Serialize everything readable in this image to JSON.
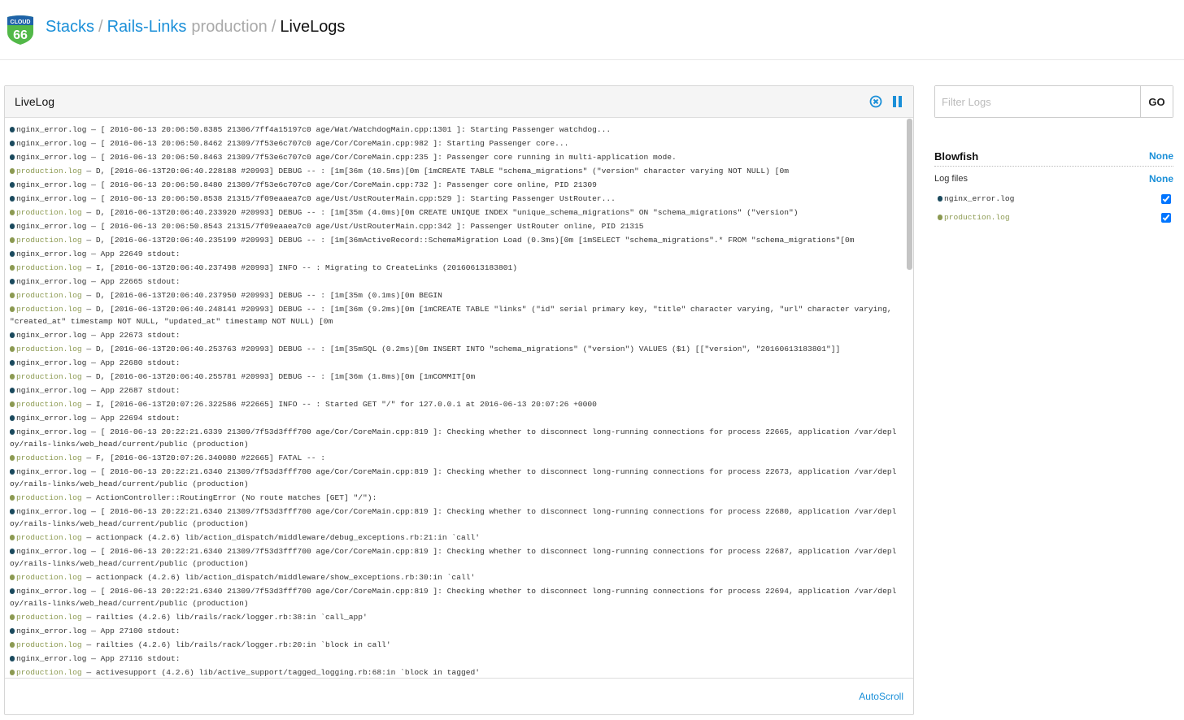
{
  "header": {
    "logo_text": [
      "CLOUD",
      "66"
    ],
    "breadcrumb": {
      "stacks": "Stacks",
      "separator": "/",
      "stack": "Rails-Links",
      "environment": "production",
      "current": "LiveLogs"
    }
  },
  "colors": {
    "accent": "#1a8fd8",
    "nginx": "#1b4a5e",
    "production": "#8c9a52"
  },
  "livelog": {
    "title": "LiveLog",
    "clear_icon": "close-circle-icon",
    "pause_icon": "pause-icon",
    "autoscroll": "AutoScroll",
    "separator": " — ",
    "entries": [
      {
        "src": "nginx_error.log",
        "text": "[ 2016-06-13 20:06:50.8385 21306/7ff4a15197c0 age/Wat/WatchdogMain.cpp:1301 ]: Starting Passenger watchdog..."
      },
      {
        "src": "nginx_error.log",
        "text": "[ 2016-06-13 20:06:50.8462 21309/7f53e6c707c0 age/Cor/CoreMain.cpp:982 ]: Starting Passenger core..."
      },
      {
        "src": "nginx_error.log",
        "text": "[ 2016-06-13 20:06:50.8463 21309/7f53e6c707c0 age/Cor/CoreMain.cpp:235 ]: Passenger core running in multi-application mode."
      },
      {
        "src": "production.log",
        "text": "D, [2016-06-13T20:06:40.228188 #20993] DEBUG -- : [1m[36m (10.5ms)[0m [1mCREATE TABLE \"schema_migrations\" (\"version\" character varying NOT NULL) [0m"
      },
      {
        "src": "nginx_error.log",
        "text": "[ 2016-06-13 20:06:50.8480 21309/7f53e6c707c0 age/Cor/CoreMain.cpp:732 ]: Passenger core online, PID 21309"
      },
      {
        "src": "nginx_error.log",
        "text": "[ 2016-06-13 20:06:50.8538 21315/7f09eaaea7c0 age/Ust/UstRouterMain.cpp:529 ]: Starting Passenger UstRouter..."
      },
      {
        "src": "production.log",
        "text": "D, [2016-06-13T20:06:40.233920 #20993] DEBUG -- : [1m[35m (4.0ms)[0m CREATE UNIQUE INDEX \"unique_schema_migrations\" ON \"schema_migrations\" (\"version\")"
      },
      {
        "src": "nginx_error.log",
        "text": "[ 2016-06-13 20:06:50.8543 21315/7f09eaaea7c0 age/Ust/UstRouterMain.cpp:342 ]: Passenger UstRouter online, PID 21315"
      },
      {
        "src": "production.log",
        "text": "D, [2016-06-13T20:06:40.235199 #20993] DEBUG -- : [1m[36mActiveRecord::SchemaMigration Load (0.3ms)[0m [1mSELECT \"schema_migrations\".* FROM \"schema_migrations\"[0m"
      },
      {
        "src": "nginx_error.log",
        "text": "App 22649 stdout:"
      },
      {
        "src": "production.log",
        "text": "I, [2016-06-13T20:06:40.237498 #20993] INFO -- : Migrating to CreateLinks (20160613183801)"
      },
      {
        "src": "nginx_error.log",
        "text": "App 22665 stdout:"
      },
      {
        "src": "production.log",
        "text": "D, [2016-06-13T20:06:40.237950 #20993] DEBUG -- : [1m[35m (0.1ms)[0m BEGIN"
      },
      {
        "src": "production.log",
        "text": "D, [2016-06-13T20:06:40.248141 #20993] DEBUG -- : [1m[36m (9.2ms)[0m [1mCREATE TABLE \"links\" (\"id\" serial primary key, \"title\" character varying, \"url\" character varying, \"created_at\" timestamp NOT NULL, \"updated_at\" timestamp NOT NULL) [0m"
      },
      {
        "src": "nginx_error.log",
        "text": "App 22673 stdout:"
      },
      {
        "src": "production.log",
        "text": "D, [2016-06-13T20:06:40.253763 #20993] DEBUG -- : [1m[35mSQL (0.2ms)[0m INSERT INTO \"schema_migrations\" (\"version\") VALUES ($1) [[\"version\", \"20160613183801\"]]"
      },
      {
        "src": "nginx_error.log",
        "text": "App 22680 stdout:"
      },
      {
        "src": "production.log",
        "text": "D, [2016-06-13T20:06:40.255781 #20993] DEBUG -- : [1m[36m (1.8ms)[0m [1mCOMMIT[0m"
      },
      {
        "src": "nginx_error.log",
        "text": "App 22687 stdout:"
      },
      {
        "src": "production.log",
        "text": "I, [2016-06-13T20:07:26.322586 #22665] INFO -- : Started GET \"/\" for 127.0.0.1 at 2016-06-13 20:07:26 +0000"
      },
      {
        "src": "nginx_error.log",
        "text": "App 22694 stdout:"
      },
      {
        "src": "nginx_error.log",
        "text": "[ 2016-06-13 20:22:21.6339 21309/7f53d3fff700 age/Cor/CoreMain.cpp:819 ]: Checking whether to disconnect long-running connections for process 22665, application /var/deploy/rails-links/web_head/current/public (production)"
      },
      {
        "src": "production.log",
        "text": "F, [2016-06-13T20:07:26.340080 #22665] FATAL -- :"
      },
      {
        "src": "nginx_error.log",
        "text": "[ 2016-06-13 20:22:21.6340 21309/7f53d3fff700 age/Cor/CoreMain.cpp:819 ]: Checking whether to disconnect long-running connections for process 22673, application /var/deploy/rails-links/web_head/current/public (production)"
      },
      {
        "src": "production.log",
        "text": "ActionController::RoutingError (No route matches [GET] \"/\"):"
      },
      {
        "src": "nginx_error.log",
        "text": "[ 2016-06-13 20:22:21.6340 21309/7f53d3fff700 age/Cor/CoreMain.cpp:819 ]: Checking whether to disconnect long-running connections for process 22680, application /var/deploy/rails-links/web_head/current/public (production)"
      },
      {
        "src": "production.log",
        "text": "actionpack (4.2.6) lib/action_dispatch/middleware/debug_exceptions.rb:21:in `call'"
      },
      {
        "src": "nginx_error.log",
        "text": "[ 2016-06-13 20:22:21.6340 21309/7f53d3fff700 age/Cor/CoreMain.cpp:819 ]: Checking whether to disconnect long-running connections for process 22687, application /var/deploy/rails-links/web_head/current/public (production)"
      },
      {
        "src": "production.log",
        "text": "actionpack (4.2.6) lib/action_dispatch/middleware/show_exceptions.rb:30:in `call'"
      },
      {
        "src": "nginx_error.log",
        "text": "[ 2016-06-13 20:22:21.6340 21309/7f53d3fff700 age/Cor/CoreMain.cpp:819 ]: Checking whether to disconnect long-running connections for process 22694, application /var/deploy/rails-links/web_head/current/public (production)"
      },
      {
        "src": "production.log",
        "text": "railties (4.2.6) lib/rails/rack/logger.rb:38:in `call_app'"
      },
      {
        "src": "nginx_error.log",
        "text": "App 27100 stdout:"
      },
      {
        "src": "production.log",
        "text": "railties (4.2.6) lib/rails/rack/logger.rb:20:in `block in call'"
      },
      {
        "src": "nginx_error.log",
        "text": "App 27116 stdout:"
      },
      {
        "src": "production.log",
        "text": "activesupport (4.2.6) lib/active_support/tagged_logging.rb:68:in `block in tagged'"
      }
    ]
  },
  "sidebar": {
    "filter_placeholder": "Filter Logs",
    "filter_value": "",
    "go_label": "GO",
    "server": {
      "name": "Blowfish",
      "none_label": "None"
    },
    "log_files": {
      "label": "Log files",
      "none_label": "None",
      "items": [
        {
          "name": "nginx_error.log",
          "checked": true
        },
        {
          "name": "production.log",
          "checked": true
        }
      ]
    }
  }
}
